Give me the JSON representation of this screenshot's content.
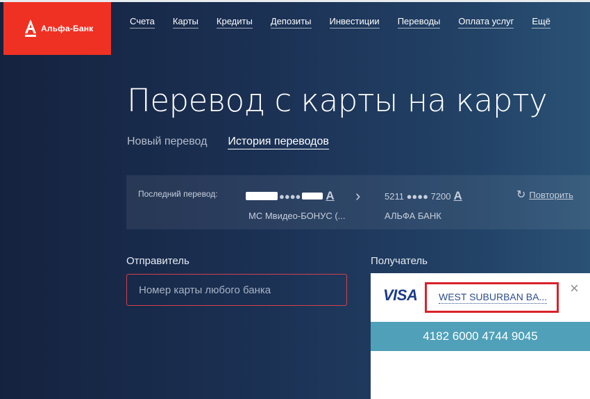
{
  "logo": {
    "text": "Альфа-Банк"
  },
  "nav": {
    "items": [
      "Счета",
      "Карты",
      "Кредиты",
      "Депозиты",
      "Инвестиции",
      "Переводы",
      "Оплата услуг",
      "Ещё"
    ]
  },
  "page": {
    "title": "Перевод с карты на карту"
  },
  "tabs": {
    "new": "Новый перевод",
    "history": "История переводов"
  },
  "last_transfer": {
    "label": "Последний перевод:",
    "from_card_mask": "●●●●",
    "from_card_brand": "A",
    "from_name": "МС Мвидео-БОНУС (...",
    "to_card": "5211 ●●●● 7200",
    "to_card_brand": "A",
    "to_name": "АЛЬФА БАНК",
    "repeat_label": "Повторить"
  },
  "sender": {
    "label": "Отправитель",
    "placeholder": "Номер карты любого банка"
  },
  "recipient": {
    "label": "Получатель",
    "card_system": "VISA",
    "bank_name": "WEST SUBURBAN BA...",
    "card_number": "4182 6000 4744 9045",
    "close_icon": "×"
  },
  "colors": {
    "brand": "#ef3124",
    "accent": "#4fa0b8",
    "highlight": "#d9212a"
  }
}
